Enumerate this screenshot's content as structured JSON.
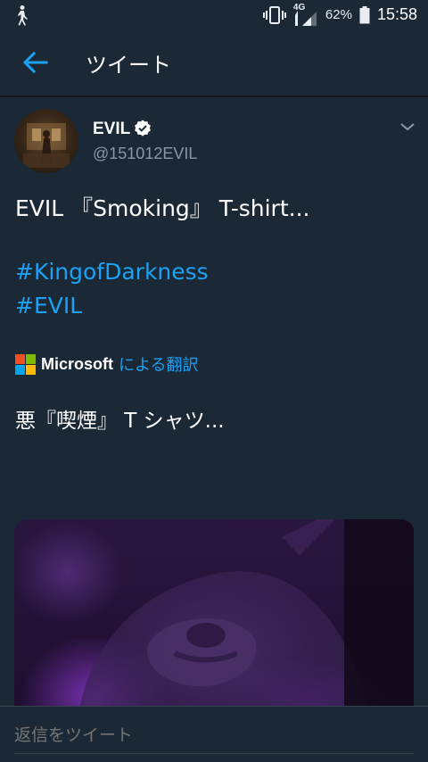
{
  "status_bar": {
    "network": "4G",
    "battery": "62%",
    "time": "15:58"
  },
  "app_bar": {
    "title": "ツイート"
  },
  "tweet": {
    "author_name": "EVIL",
    "author_handle": "@151012EVIL",
    "text": "EVIL 『Smoking』 T-shirt...",
    "hashtags": [
      "#KingofDarkness",
      "#EVIL"
    ],
    "translation": {
      "brand": "Microsoft",
      "by_label": "による翻訳",
      "text": "悪『喫煙』 T シャツ..."
    }
  },
  "reply": {
    "placeholder": "返信をツイート"
  },
  "colors": {
    "background": "#1b2836",
    "accent": "#1da1f2",
    "secondary_text": "#8899a6"
  },
  "icons": {
    "status_left": "walking-person-icon",
    "vibrate": "vibrate-icon",
    "signal": "signal-icon",
    "battery": "battery-icon",
    "back": "back-arrow-icon",
    "verified": "verified-badge-icon",
    "menu": "chevron-down-icon",
    "translator": "microsoft-logo-icon"
  }
}
